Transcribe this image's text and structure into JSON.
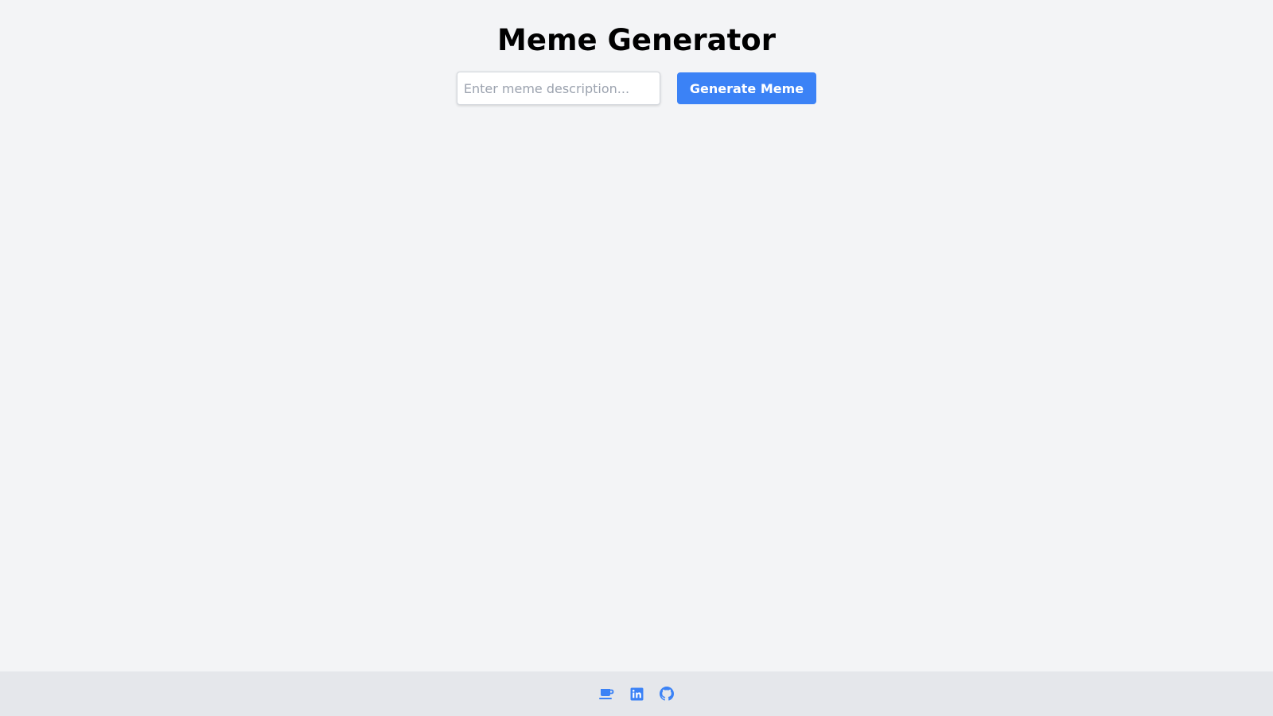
{
  "header": {
    "title": "Meme Generator"
  },
  "form": {
    "description_placeholder": "Enter meme description...",
    "description_value": "",
    "generate_label": "Generate Meme"
  },
  "footer": {
    "links": [
      {
        "icon": "coffee-cup-icon"
      },
      {
        "icon": "linkedin-icon"
      },
      {
        "icon": "github-icon"
      }
    ]
  },
  "colors": {
    "background": "#f3f4f6",
    "footer_background": "#e5e7eb",
    "accent": "#3b82f6",
    "title_text": "#000000",
    "placeholder_text": "#9ca3af"
  }
}
